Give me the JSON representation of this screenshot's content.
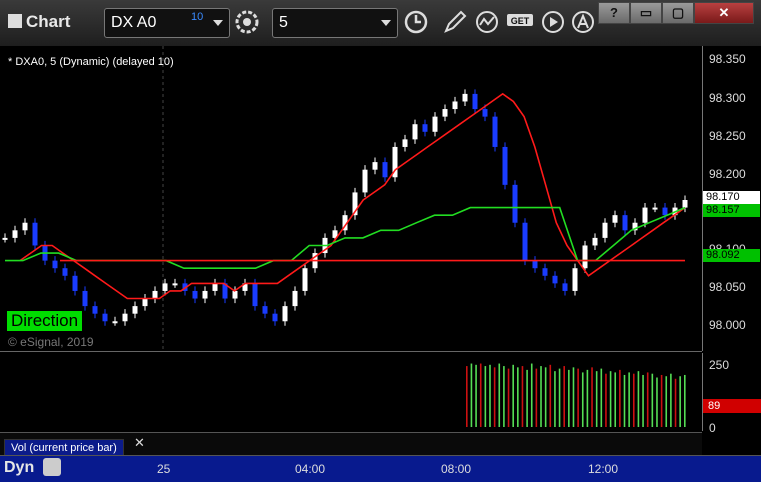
{
  "window": {
    "title": "Chart",
    "symbol": "DX A0",
    "symbol_superscript": "10",
    "interval": "5",
    "buttons": [
      "?",
      "▭",
      "▢",
      "✕"
    ]
  },
  "chart": {
    "info": "* DXA0, 5 (Dynamic) (delayed 10)",
    "watermark": "© eSignal, 2019",
    "study_label": "Direction",
    "vol_label": "Vol (current price bar)",
    "close_x": "✕",
    "dyn_label": "Dyn",
    "price_ticks": [
      "98.350",
      "98.300",
      "98.250",
      "98.200",
      "98.150",
      "98.100",
      "98.050",
      "98.000"
    ],
    "price_tags": [
      {
        "label": "98.170",
        "bg": "#ffffff",
        "fg": "#000000"
      },
      {
        "label": "98.157",
        "bg": "#00c000",
        "fg": "#000000"
      },
      {
        "label": "98.092",
        "bg": "#00c000",
        "fg": "#000000"
      }
    ],
    "vol_ticks": [
      "250",
      "0"
    ],
    "vol_tag": {
      "label": "89",
      "bg": "#d00000",
      "fg": "#ffffff"
    },
    "time_labels": [
      "25",
      "04:00",
      "08:00",
      "12:00"
    ]
  },
  "chart_data": {
    "type": "line",
    "title": "",
    "ylim": [
      97.98,
      98.36
    ],
    "x_ticks": [
      "25",
      "04:00",
      "08:00",
      "12:00"
    ],
    "series": [
      {
        "values": [
          98.12,
          98.13,
          98.14,
          98.11,
          98.09,
          98.08,
          98.07,
          98.05,
          98.03,
          98.02,
          98.01,
          98.01,
          98.02,
          98.03,
          98.04,
          98.05,
          98.06,
          98.06,
          98.05,
          98.04,
          98.05,
          98.06,
          98.04,
          98.05,
          98.06,
          98.03,
          98.02,
          98.01,
          98.03,
          98.05,
          98.08,
          98.1,
          98.12,
          98.13,
          98.15,
          98.18,
          98.21,
          98.22,
          98.2,
          98.24,
          98.25,
          98.27,
          98.26,
          98.28,
          98.29,
          98.3,
          98.31,
          98.29,
          98.28,
          98.24,
          98.19,
          98.14,
          98.09,
          98.08,
          98.07,
          98.06,
          98.05,
          98.08,
          98.11,
          98.12,
          98.14,
          98.15,
          98.13,
          98.14,
          98.16,
          98.16,
          98.15,
          98.16,
          98.17
        ]
      },
      {
        "values": [
          98.09,
          98.1,
          98.11,
          98.11,
          98.1,
          98.09,
          98.08,
          98.07,
          98.06,
          98.05,
          98.04,
          98.04,
          98.04,
          98.04,
          98.05,
          98.05,
          98.06,
          98.06,
          98.06,
          98.06,
          98.05,
          98.06,
          98.06,
          98.06,
          98.06,
          98.07,
          98.08,
          98.09,
          98.1,
          98.11,
          98.13,
          98.15,
          98.17,
          98.18,
          98.19,
          98.21,
          98.22,
          98.23,
          98.24,
          98.25,
          98.26,
          98.27,
          98.28,
          98.29,
          98.3,
          98.31,
          98.3,
          98.28,
          98.24,
          98.19,
          98.14,
          98.11,
          98.09,
          98.07,
          98.08,
          98.09,
          98.1,
          98.11,
          98.12,
          98.13,
          98.14,
          98.15,
          98.16
        ]
      },
      {
        "values": [
          98.09,
          98.09,
          98.1,
          98.1,
          98.09,
          98.09,
          98.09,
          98.09,
          98.09,
          98.09,
          98.08,
          98.08,
          98.08,
          98.08,
          98.08,
          98.09,
          98.09,
          98.11,
          98.11,
          98.12,
          98.12,
          98.13,
          98.13,
          98.14,
          98.15,
          98.15,
          98.16,
          98.16,
          98.16,
          98.16,
          98.16,
          98.16,
          98.09,
          98.09,
          98.11,
          98.13,
          98.14,
          98.15,
          98.16
        ]
      },
      {
        "values": [
          98.09,
          98.09,
          98.09,
          98.09,
          98.09,
          98.09,
          98.09,
          98.09,
          98.09,
          98.09,
          98.09,
          98.09,
          98.09,
          98.09,
          98.09,
          98.09,
          98.09,
          98.09,
          98.09,
          98.09,
          98.09,
          98.09,
          98.09,
          98.09,
          98.09,
          98.09,
          98.09,
          98.09,
          98.09,
          98.09,
          98.09,
          98.09,
          98.09,
          98.09,
          98.09,
          98.09,
          98.09,
          98.09,
          98.09,
          98.09,
          98.09,
          98.09,
          98.09,
          98.09,
          98.09,
          98.09,
          98.09,
          98.09,
          98.09
        ]
      }
    ],
    "volume": {
      "ylim": [
        0,
        260
      ],
      "values": [
        240,
        250,
        245,
        250,
        240,
        245,
        235,
        250,
        240,
        230,
        245,
        235,
        240,
        225,
        250,
        230,
        240,
        235,
        245,
        220,
        230,
        240,
        225,
        235,
        230,
        215,
        225,
        235,
        220,
        230,
        210,
        220,
        215,
        225,
        205,
        215,
        210,
        220,
        205,
        215,
        210,
        195,
        205,
        200,
        210,
        190,
        200,
        205
      ]
    }
  },
  "colors": {
    "up_bar": "#ffffff",
    "down_bar": "#1a3cff",
    "ma_red": "#ff1a1a",
    "ma_green": "#22dd22",
    "vol_red": "#cc1111",
    "vol_green": "#55dd55",
    "axis_blue": "#081a8e"
  },
  "icons": [
    "settings-icon",
    "clock-icon",
    "pencil-icon",
    "indicator-icon",
    "get-icon",
    "play-icon",
    "alert-icon"
  ]
}
